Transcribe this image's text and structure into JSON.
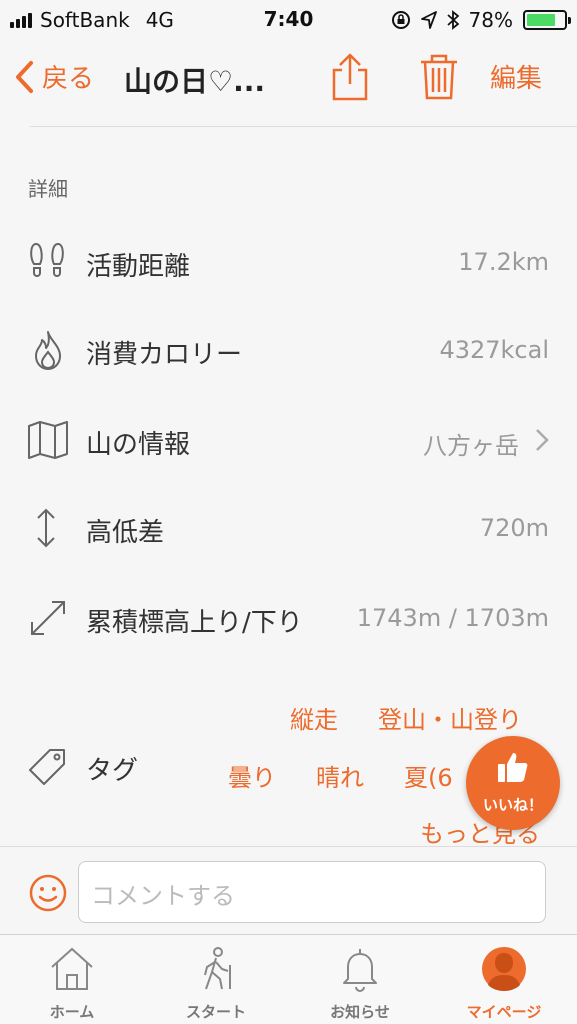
{
  "status_bar": {
    "carrier": "SoftBank",
    "network": "4G",
    "time": "7:40",
    "battery_percent": "78%",
    "battery_level": 0.78
  },
  "nav": {
    "back_label": "戻る",
    "title": "山の日♡...",
    "edit_label": "編集"
  },
  "details": {
    "section_title": "詳細",
    "rows": [
      {
        "label": "活動距離",
        "value": "17.2km",
        "icon": "footprints-icon"
      },
      {
        "label": "消費カロリー",
        "value": "4327kcal",
        "icon": "flame-icon"
      },
      {
        "label": "山の情報",
        "value": "八方ヶ岳",
        "icon": "map-icon"
      },
      {
        "label": "高低差",
        "value": "720m",
        "icon": "vertical-arrows-icon"
      },
      {
        "label": "累積標高上り/下り",
        "value": "1743m / 1703m",
        "icon": "diagonal-arrows-icon"
      }
    ]
  },
  "tags": {
    "label": "タグ",
    "items": [
      "縦走",
      "登山・山登り",
      "曇り",
      "晴れ",
      "夏(6"
    ],
    "more_label": "もっと見る"
  },
  "like_button": {
    "label": "いいね！"
  },
  "comment": {
    "placeholder": "コメントする"
  },
  "tab_bar": {
    "tabs": [
      {
        "label": "ホーム",
        "icon": "home-icon"
      },
      {
        "label": "スタート",
        "icon": "walker-icon"
      },
      {
        "label": "お知らせ",
        "icon": "bell-icon"
      },
      {
        "label": "マイページ",
        "icon": "user-icon"
      }
    ],
    "active_index": 3
  },
  "colors": {
    "accent": "#ec6b2d",
    "background": "#f6f6f6",
    "value_gray": "#9a9a9a"
  }
}
